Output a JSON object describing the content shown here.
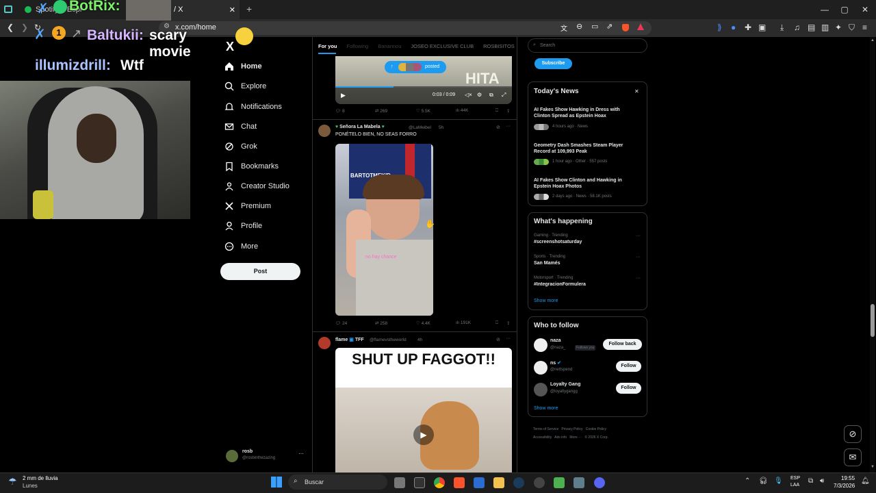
{
  "browser": {
    "tabs": [
      {
        "label": "Spotify – Espr"
      },
      {
        "label": "/ X"
      }
    ],
    "url": "x.com/home",
    "new_tab": "+",
    "window_controls": [
      "—",
      "▢",
      "✕"
    ]
  },
  "overlay": {
    "chat_lines": [
      {
        "user": "BotRix:",
        "text": ""
      },
      {
        "user": "Baltukii:",
        "text": "scary movie"
      },
      {
        "user": "illumizdrill:",
        "text": "Wtf"
      }
    ],
    "badge_number": "1"
  },
  "x_nav": {
    "logo": "X",
    "items": [
      {
        "label": "Home",
        "icon": "home-icon"
      },
      {
        "label": "Explore",
        "icon": "search-icon"
      },
      {
        "label": "Notifications",
        "icon": "bell-icon"
      },
      {
        "label": "Chat",
        "icon": "mail-icon"
      },
      {
        "label": "Grok",
        "icon": "grok-icon"
      },
      {
        "label": "Bookmarks",
        "icon": "bookmark-icon"
      },
      {
        "label": "Creator Studio",
        "icon": "creator-icon"
      },
      {
        "label": "Premium",
        "icon": "x-icon"
      },
      {
        "label": "Profile",
        "icon": "person-icon"
      },
      {
        "label": "More",
        "icon": "more-icon"
      }
    ],
    "post_label": "Post",
    "account": {
      "name": "rosb",
      "handle": "@rosbinthezazing"
    }
  },
  "timeline": {
    "tabs": [
      "For you",
      "Following",
      "Banannou",
      "JOSEO EXCLUSIVE CLUB",
      "ROSBISITOS"
    ],
    "video": {
      "posted_label": "posted",
      "time": "0:03 / 0:09",
      "watermark": "HITA"
    },
    "post0_actions": {
      "replies": "8",
      "reposts": "269",
      "likes": "5.5K",
      "views": "44K"
    },
    "post1": {
      "name": "Señora La Mabela",
      "handle": "@LaMeibel",
      "time": "5h",
      "text": "PONÉTELO BIEN, NO SEAS FORRO",
      "img_tag": "BARTOTMEKID",
      "img_caption": "no hay chance",
      "actions": {
        "replies": "24",
        "reposts": "258",
        "likes": "4.4K",
        "views": "191K"
      }
    },
    "post2": {
      "name": "flame",
      "suffix": "TFF",
      "handle": "@flamevstheworld",
      "time": "4h",
      "meme_text": "SHUT UP FAGGOT!!"
    }
  },
  "right": {
    "search_placeholder": "Search",
    "subscribe": "Subscribe",
    "news": {
      "title": "Today's News",
      "items": [
        {
          "title": "AI Fakes Show Hawking in Dress with Clinton Spread as Epstein Hoax",
          "meta": "4 hours ago · News"
        },
        {
          "title": "Geometry Dash Smashes Steam Player Record at 109,993 Peak",
          "meta": "1 hour ago · Other · 557 posts"
        },
        {
          "title": "AI Fakes Show Clinton and Hawking in Epstein Hoax Photos",
          "meta": "2 days ago · News · 58.1K posts"
        }
      ]
    },
    "happening": {
      "title": "What's happening",
      "items": [
        {
          "context": "Gaming · Trending",
          "topic": "#screenshotsaturday"
        },
        {
          "context": "Sports · Trending",
          "topic": "San Mamés"
        },
        {
          "context": "Motorsport · Trending",
          "topic": "#IntegracionFormulera"
        }
      ],
      "show_more": "Show more"
    },
    "follow": {
      "title": "Who to follow",
      "items": [
        {
          "name": "naza",
          "handle": "@naza_",
          "tag": "Follows you",
          "button": "Follow back"
        },
        {
          "name": "ns",
          "handle": "@nettspend",
          "button": "Follow"
        },
        {
          "name": "Loyalty Gang",
          "handle": "@loyaltygangg",
          "button": "Follow"
        }
      ],
      "show_more": "Show more"
    },
    "footer": [
      "Terms of Service",
      "Privacy Policy",
      "Cookie Policy",
      "Accessibility",
      "Ads info",
      "More ···",
      "© 2026 X Corp."
    ]
  },
  "taskbar": {
    "weather": "2 mm de lluvia",
    "day": "Lunes",
    "search": "Buscar",
    "lang1": "ESP",
    "lang2": "LAA",
    "time": "19:55",
    "date": "7/3/2026"
  }
}
